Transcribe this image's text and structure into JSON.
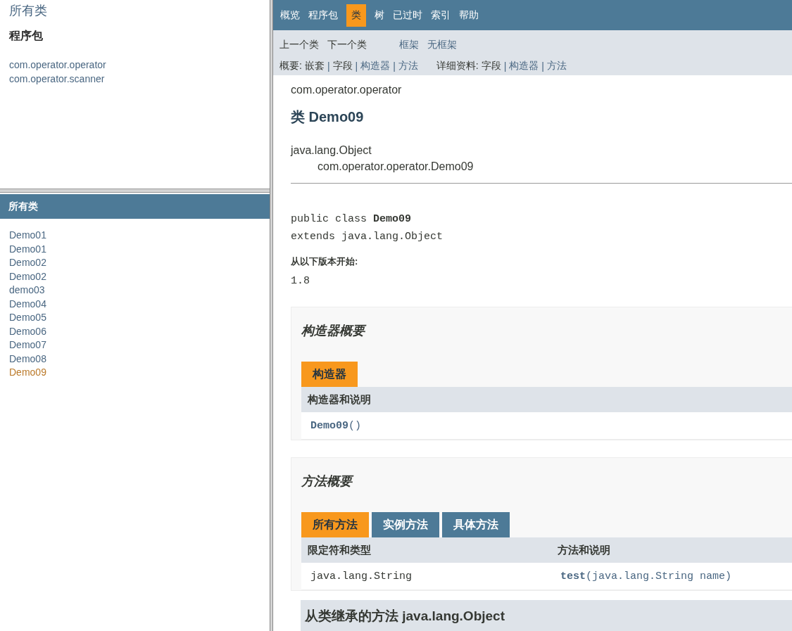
{
  "left_top": {
    "title": "所有类",
    "heading": "程序包",
    "packages": [
      "com.operator.operator",
      "com.operator.scanner"
    ]
  },
  "left_bottom": {
    "header": "所有类",
    "classes": [
      {
        "label": "Demo01",
        "selected": false
      },
      {
        "label": "Demo01",
        "selected": false
      },
      {
        "label": "Demo02",
        "selected": false
      },
      {
        "label": "Demo02",
        "selected": false
      },
      {
        "label": "demo03",
        "selected": false
      },
      {
        "label": "Demo04",
        "selected": false
      },
      {
        "label": "Demo05",
        "selected": false
      },
      {
        "label": "Demo06",
        "selected": false
      },
      {
        "label": "Demo07",
        "selected": false
      },
      {
        "label": "Demo08",
        "selected": false
      },
      {
        "label": "Demo09",
        "selected": true
      }
    ]
  },
  "nav": {
    "items": [
      {
        "label": "概览",
        "selected": false
      },
      {
        "label": "程序包",
        "selected": false
      },
      {
        "label": "类",
        "selected": true
      },
      {
        "label": "树",
        "selected": false
      },
      {
        "label": "已过时",
        "selected": false
      },
      {
        "label": "索引",
        "selected": false
      },
      {
        "label": "帮助",
        "selected": false
      }
    ]
  },
  "subnav": {
    "groups": [
      [
        {
          "label": "上一个类",
          "link": false
        },
        {
          "label": "下一个类",
          "link": false
        }
      ],
      [
        {
          "label": "框架",
          "link": true
        },
        {
          "label": "无框架",
          "link": true
        }
      ]
    ],
    "summary_lines": [
      {
        "label": "概要:",
        "items": [
          {
            "label": "嵌套",
            "link": false
          },
          {
            "label": "字段",
            "link": false
          },
          {
            "label": "构造器",
            "link": true
          },
          {
            "label": "方法",
            "link": true
          }
        ]
      },
      {
        "label": "详细资料:",
        "items": [
          {
            "label": "字段",
            "link": false
          },
          {
            "label": "构造器",
            "link": true
          },
          {
            "label": "方法",
            "link": true
          }
        ]
      }
    ],
    "separator": "|"
  },
  "content": {
    "package": "com.operator.operator",
    "title": "类 Demo09",
    "inheritance": [
      "java.lang.Object",
      "com.operator.operator.Demo09"
    ],
    "signature": [
      "public class **Demo09**",
      "extends java.lang.Object"
    ],
    "since_label": "从以下版本开始:",
    "since": "1.8",
    "constructor_summary": {
      "heading": "构造器概要",
      "tabs": [
        {
          "label": "构造器",
          "selected": true
        }
      ],
      "columns": [
        "构造器和说明"
      ],
      "rows": [
        [
          "**Demo09**()"
        ]
      ]
    },
    "method_summary": {
      "heading": "方法概要",
      "tabs": [
        {
          "label": "所有方法",
          "selected": true
        },
        {
          "label": "实例方法",
          "selected": false
        },
        {
          "label": "具体方法",
          "selected": false
        }
      ],
      "columns": [
        "限定符和类型",
        "方法和说明"
      ],
      "rows": [
        [
          "java.lang.String",
          "**test**(java.lang.String  name)"
        ]
      ]
    },
    "inherited_heading": "从类继承的方法 java.lang.Object"
  }
}
